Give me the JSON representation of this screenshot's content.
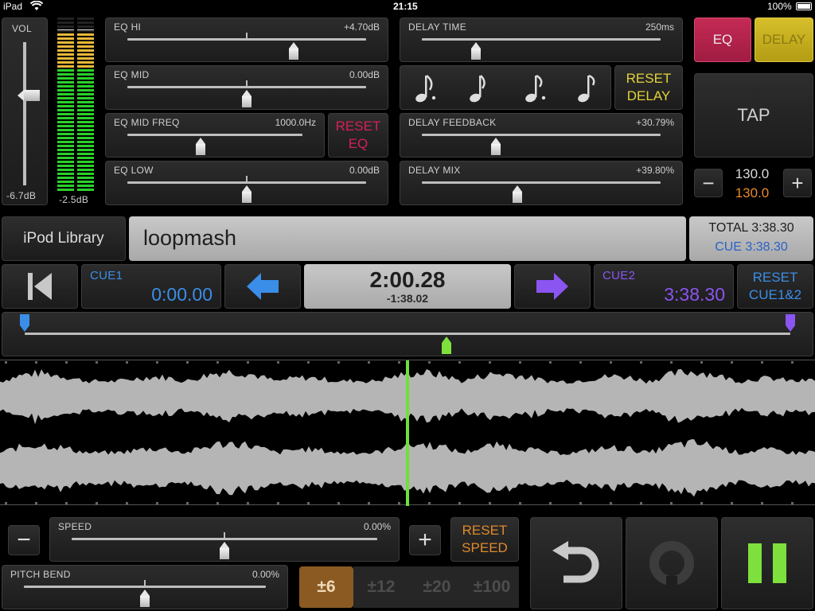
{
  "status": {
    "device": "iPad",
    "time": "21:15",
    "battery": "100%"
  },
  "volume": {
    "label": "VOL",
    "value": "-6.7dB",
    "meter_value": "-2.5dB"
  },
  "eq": {
    "hi": {
      "label": "EQ HI",
      "value": "+4.70dB"
    },
    "mid": {
      "label": "EQ MID",
      "value": "0.00dB"
    },
    "mid_freq": {
      "label": "EQ MID FREQ",
      "value": "1000.0Hz"
    },
    "low": {
      "label": "EQ LOW",
      "value": "0.00dB"
    },
    "reset_line1": "RESET",
    "reset_line2": "EQ"
  },
  "delay": {
    "time": {
      "label": "DELAY TIME",
      "value": "250ms"
    },
    "feedback": {
      "label": "DELAY FEEDBACK",
      "value": "+30.79%"
    },
    "mix": {
      "label": "DELAY MIX",
      "value": "+39.80%"
    },
    "reset_line1": "RESET",
    "reset_line2": "DELAY",
    "notes": [
      "dotted-eighth-note",
      "quarter-note",
      "dotted-sixteenth-note",
      "eighth-note"
    ]
  },
  "mode_tabs": {
    "eq": "EQ",
    "delay": "DELAY"
  },
  "tap": {
    "label": "TAP",
    "bpm": "130.0",
    "bpm_orig": "130.0",
    "minus": "−",
    "plus": "+"
  },
  "track": {
    "library": "iPod Library",
    "title": "loopmash",
    "total": "TOTAL 3:38.30",
    "cue_total": "CUE 3:38.30"
  },
  "transport": {
    "cue1_label": "CUE1",
    "cue1_time": "0:00.00",
    "position": "2:00.28",
    "remaining": "-1:38.02",
    "cue2_label": "CUE2",
    "cue2_time": "3:38.30",
    "reset_line1": "RESET",
    "reset_line2": "CUE1&2"
  },
  "speed": {
    "label": "SPEED",
    "value": "0.00%",
    "minus": "−",
    "plus": "+",
    "reset_line1": "RESET",
    "reset_line2": "SPEED"
  },
  "pitch_bend": {
    "label": "PITCH BEND",
    "value": "0.00%"
  },
  "ranges": [
    "±6",
    "±12",
    "±20",
    "±100"
  ],
  "playback": {
    "position_fraction": 0.55,
    "cue1_fraction": 0.0,
    "cue2_fraction": 1.0
  },
  "colors": {
    "cue1": "#3b8ee8",
    "cue2": "#8a55f0",
    "eq_tab": "#b8234a",
    "delay_tab": "#c8b020",
    "reset_eq": "#d42058",
    "reset_delay": "#e3d23a",
    "reset_speed": "#e08a2a",
    "play": "#7ee03c",
    "range_active": "#8a5a22"
  }
}
